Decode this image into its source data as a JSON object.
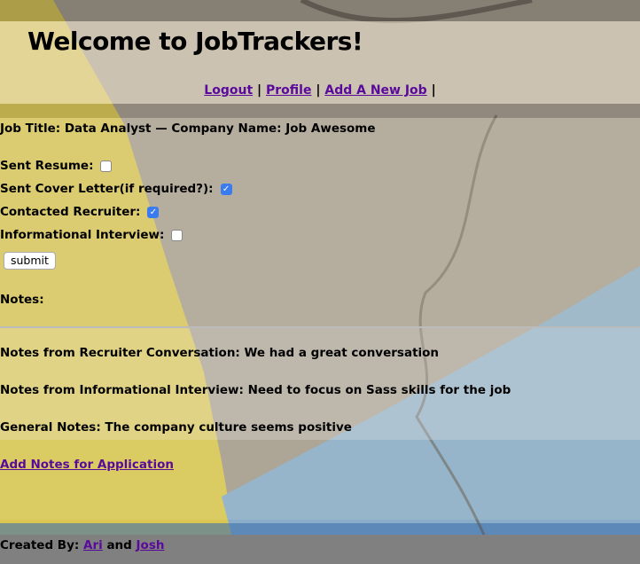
{
  "header": {
    "title": "Welcome to JobTrackers!"
  },
  "nav": {
    "logout": "Logout",
    "profile": "Profile",
    "add_job": "Add A New Job",
    "separator": "|"
  },
  "job": {
    "heading": "Job Title: Data Analyst — Company Name: Job Awesome"
  },
  "checklist": [
    {
      "label": "Sent Resume:",
      "checked": false
    },
    {
      "label": "Sent Cover Letter(if required?):",
      "checked": true
    },
    {
      "label": "Contacted Recruiter:",
      "checked": true
    },
    {
      "label": "Informational Interview:",
      "checked": false
    }
  ],
  "submit_label": "submit",
  "notes": {
    "heading": "Notes:",
    "recruiter": "Notes from Recruiter Conversation: We had a great conversation",
    "informational": "Notes from Informational Interview: Need to focus on Sass skills for the job",
    "general": "General Notes: The company culture seems positive",
    "add_link": "Add Notes for Application"
  },
  "footer": {
    "created_by": "Created By:",
    "author1": "Ari",
    "and": "and",
    "author2": "Josh"
  },
  "colors": {
    "link": "#5a0a9a",
    "checkbox": "#3a7bf0",
    "footer": "#808080"
  }
}
